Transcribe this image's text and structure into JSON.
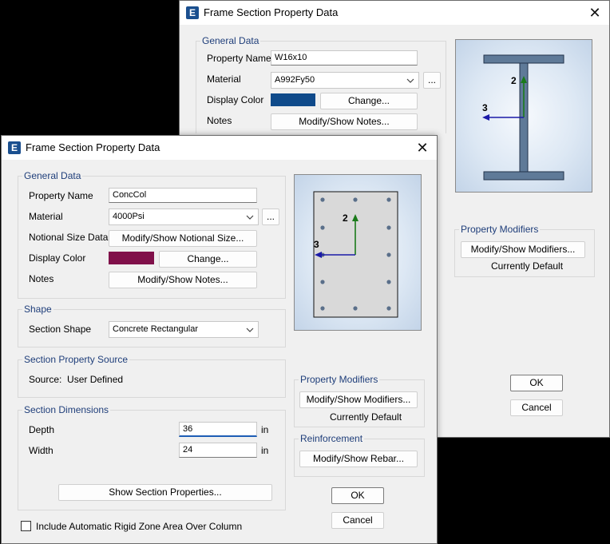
{
  "back_window": {
    "title": "Frame Section Property Data",
    "general_data": {
      "title": "General Data",
      "property_name_label": "Property Name",
      "property_name_value": "W16x10",
      "material_label": "Material",
      "material_value": "A992Fy50",
      "more_label": "...",
      "display_color_label": "Display Color",
      "display_color": "#0f4a8a",
      "change_label": "Change...",
      "notes_label": "Notes",
      "notes_button": "Modify/Show Notes..."
    },
    "property_modifiers": {
      "title": "Property Modifiers",
      "button": "Modify/Show Modifiers...",
      "status": "Currently Default"
    },
    "preview": {
      "axis_2": "2",
      "axis_3": "3"
    },
    "ok_label": "OK",
    "cancel_label": "Cancel"
  },
  "front_window": {
    "title": "Frame Section Property Data",
    "general_data": {
      "title": "General Data",
      "property_name_label": "Property Name",
      "property_name_value": "ConcCol",
      "material_label": "Material",
      "material_value": "4000Psi",
      "more_label": "...",
      "notional_size_label": "Notional Size Data",
      "notional_size_button": "Modify/Show Notional Size...",
      "display_color_label": "Display Color",
      "display_color": "#80104a",
      "change_label": "Change...",
      "notes_label": "Notes",
      "notes_button": "Modify/Show Notes..."
    },
    "shape": {
      "title": "Shape",
      "section_shape_label": "Section Shape",
      "section_shape_value": "Concrete Rectangular"
    },
    "section_property_source": {
      "title": "Section Property Source",
      "source_text": "Source:  User Defined"
    },
    "section_dimensions": {
      "title": "Section Dimensions",
      "depth_label": "Depth",
      "depth_value": "36",
      "depth_unit": "in",
      "width_label": "Width",
      "width_value": "24",
      "width_unit": "in",
      "show_properties_button": "Show Section Properties..."
    },
    "property_modifiers": {
      "title": "Property Modifiers",
      "button": "Modify/Show Modifiers...",
      "status": "Currently Default"
    },
    "reinforcement": {
      "title": "Reinforcement",
      "button": "Modify/Show Rebar..."
    },
    "preview": {
      "axis_2": "2",
      "axis_3": "3"
    },
    "ok_label": "OK",
    "cancel_label": "Cancel",
    "rigid_zone_label": "Include Automatic Rigid Zone Area Over Column",
    "rigid_zone_checked": false
  },
  "colors": {
    "group_title": "#1f3e7a",
    "steel_fill": "#5f7a98",
    "axis_2": "#1a7a1a",
    "axis_3": "#1a1aa8",
    "rebar": "#5a6f8a"
  },
  "icons": {
    "app": "etabs-app-icon",
    "close": "close-icon",
    "dropdown": "chevron-down-icon"
  }
}
